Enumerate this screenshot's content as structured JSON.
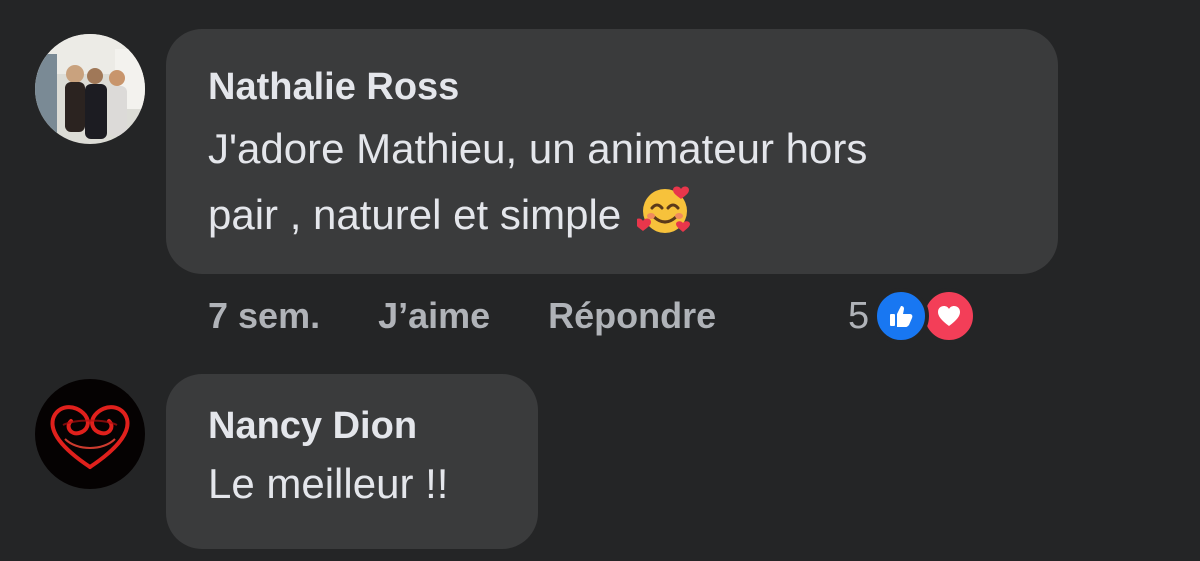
{
  "comments": [
    {
      "author": "Nathalie Ross",
      "text_line1": "J'adore Mathieu, un animateur hors",
      "text_line2": "pair , naturel et simple",
      "emoji": "smiling-face-with-hearts",
      "time": "7 sem.",
      "like_label": "J’aime",
      "reply_label": "Répondre",
      "reaction_count": "5",
      "reactions": [
        "like-icon",
        "love-icon"
      ]
    },
    {
      "author": "Nancy Dion",
      "text": "Le meilleur !!"
    }
  ],
  "colors": {
    "background": "#242526",
    "bubble": "#3a3b3c",
    "text": "#e4e6eb",
    "secondary_text": "#b0b3b8",
    "like_blue": "#1877f2",
    "love_red": "#f33e58"
  }
}
